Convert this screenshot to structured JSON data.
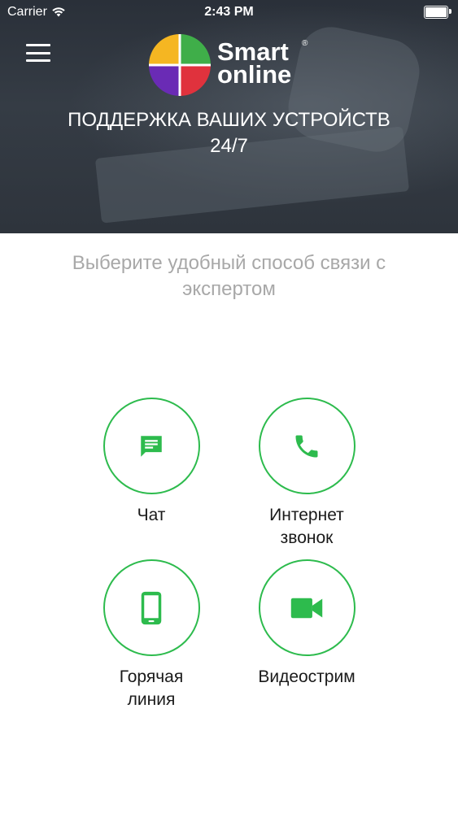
{
  "status_bar": {
    "carrier": "Carrier",
    "time": "2:43 PM"
  },
  "header": {
    "logo_line1": "Smart",
    "logo_line2": "online",
    "logo_reg": "®",
    "tagline_line1": "ПОДДЕРЖКА ВАШИХ УСТРОЙСТВ",
    "tagline_line2": "24/7"
  },
  "main": {
    "subtitle_line1": "Выберите удобный способ связи с",
    "subtitle_line2": "экспертом",
    "options": [
      {
        "label_line1": "Чат",
        "label_line2": "",
        "icon": "chat-icon"
      },
      {
        "label_line1": "Интернет",
        "label_line2": "звонок",
        "icon": "phone-icon"
      },
      {
        "label_line1": "Горячая",
        "label_line2": "линия",
        "icon": "mobile-phone-icon"
      },
      {
        "label_line1": "Видеострим",
        "label_line2": "",
        "icon": "video-camera-icon"
      }
    ]
  },
  "colors": {
    "accent_green": "#2dbb4d",
    "logo_yellow": "#f5b622",
    "logo_green": "#3fae49",
    "logo_purple": "#6a2bb5",
    "logo_red": "#e0323d"
  }
}
